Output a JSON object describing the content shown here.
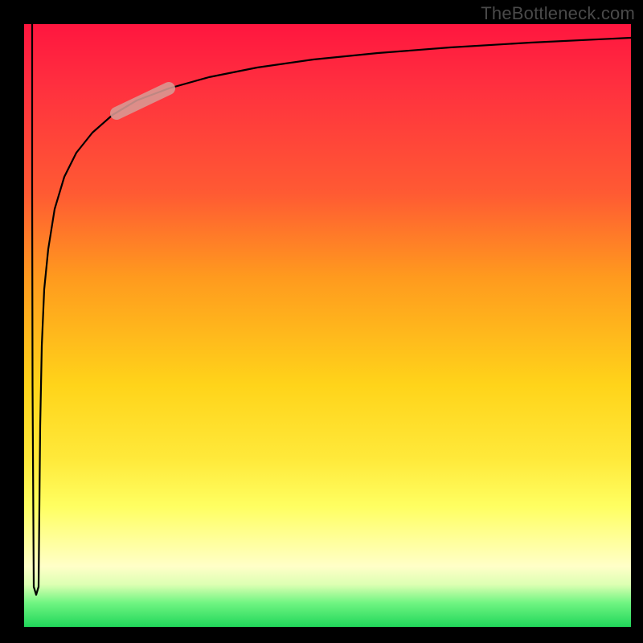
{
  "watermark": "TheBottleneck.com",
  "colors": {
    "gradient_top": "#ff163f",
    "gradient_mid1": "#ff9a1e",
    "gradient_mid2": "#ffe93a",
    "gradient_bottom": "#20d65a",
    "curve": "#000000",
    "highlight": "#d89a94",
    "background": "#000000",
    "watermark_text": "#4a4a4a"
  },
  "chart_data": {
    "type": "line",
    "title": "",
    "xlabel": "",
    "ylabel": "",
    "xlim": [
      0,
      100
    ],
    "ylim": [
      0,
      100
    ],
    "series": [
      {
        "name": "curve",
        "x": [
          1,
          1.2,
          1.5,
          1.8,
          2,
          2.5,
          3,
          4,
          5,
          7,
          10,
          14,
          18,
          24,
          30,
          38,
          48,
          58,
          70,
          83,
          100
        ],
        "y": [
          100,
          40,
          5,
          6,
          20,
          47,
          56,
          63,
          70,
          75,
          79,
          82,
          85,
          87,
          89,
          91,
          93,
          94,
          95,
          96,
          98
        ]
      }
    ],
    "highlight_range_x": [
      15,
      24
    ],
    "background_gradient_stops": [
      {
        "pos": 0.0,
        "color": "#ff163f"
      },
      {
        "pos": 0.28,
        "color": "#ff5a33"
      },
      {
        "pos": 0.6,
        "color": "#ffd41a"
      },
      {
        "pos": 0.9,
        "color": "#ffffc8"
      },
      {
        "pos": 1.0,
        "color": "#20d65a"
      }
    ]
  }
}
